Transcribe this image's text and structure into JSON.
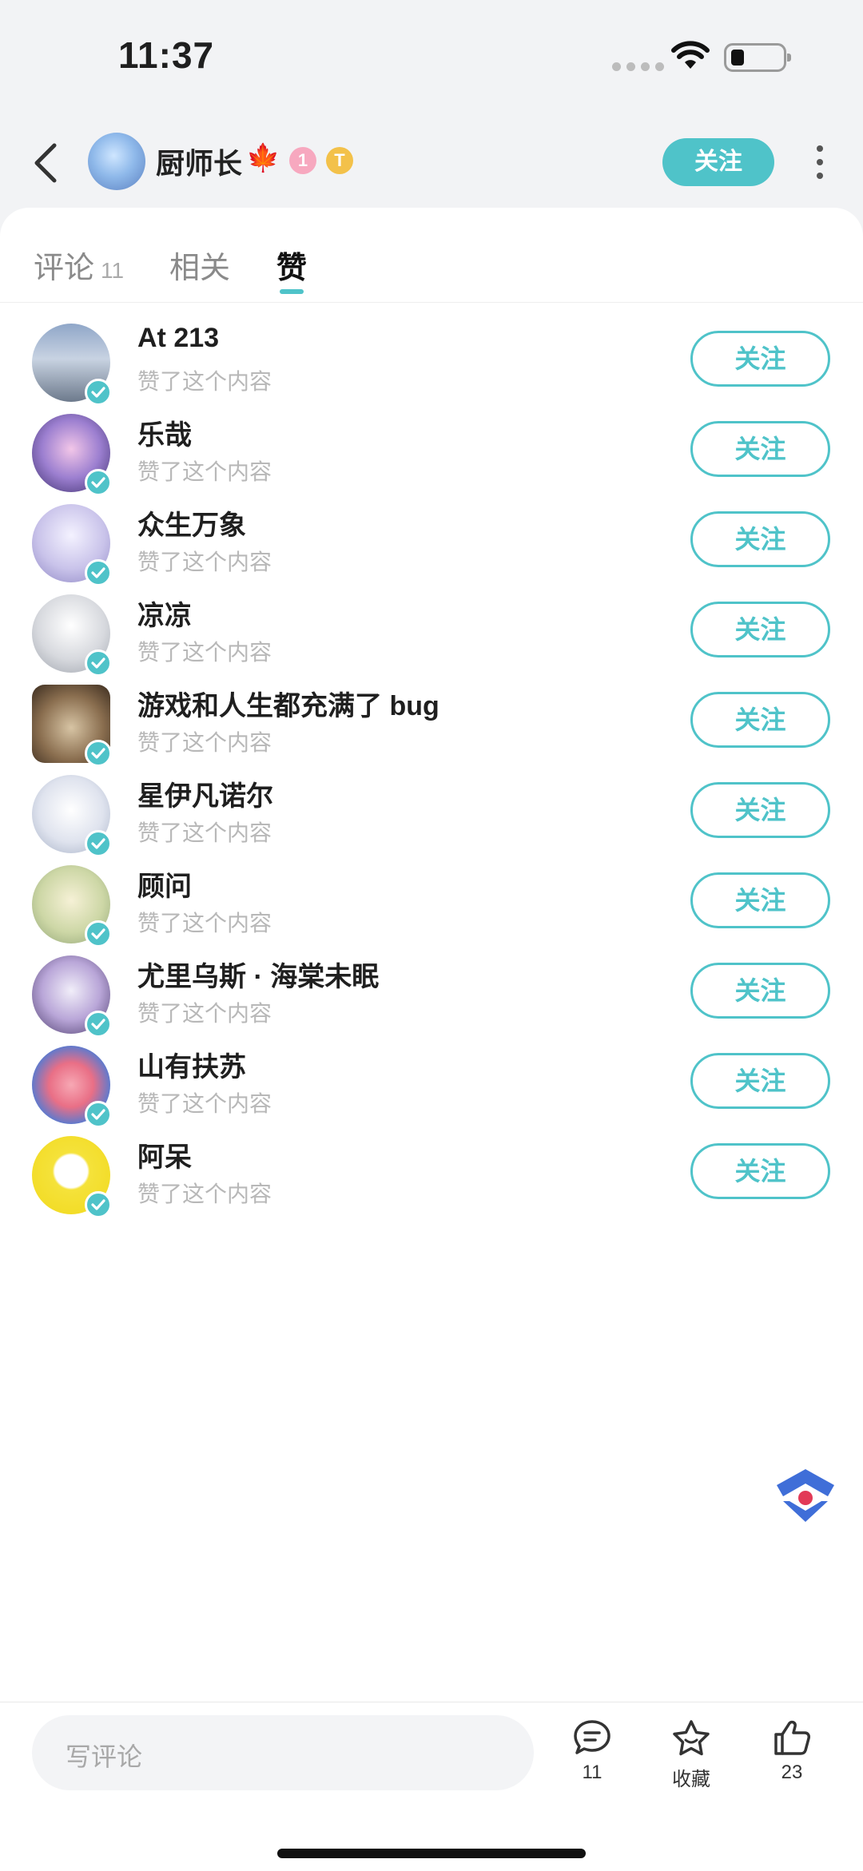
{
  "status": {
    "time": "11:37"
  },
  "header": {
    "username": "厨师长",
    "badge1": "1",
    "badge2": "T",
    "follow_label": "关注"
  },
  "tabs": [
    {
      "label": "评论",
      "count": "11"
    },
    {
      "label": "相关"
    },
    {
      "label": "赞"
    }
  ],
  "likes": [
    {
      "name": "At 213",
      "subtitle": "赞了这个内容",
      "button": "关注"
    },
    {
      "name": "乐哉",
      "subtitle": "赞了这个内容",
      "button": "关注"
    },
    {
      "name": "众生万象",
      "subtitle": "赞了这个内容",
      "button": "关注"
    },
    {
      "name": "凉凉",
      "subtitle": "赞了这个内容",
      "button": "关注"
    },
    {
      "name": "游戏和人生都充满了 bug",
      "subtitle": "赞了这个内容",
      "button": "关注"
    },
    {
      "name": "星伊凡诺尔",
      "subtitle": "赞了这个内容",
      "button": "关注"
    },
    {
      "name": "顾问",
      "subtitle": "赞了这个内容",
      "button": "关注"
    },
    {
      "name": "尤里乌斯 · 海棠未眠",
      "subtitle": "赞了这个内容",
      "button": "关注"
    },
    {
      "name": "山有扶苏",
      "subtitle": "赞了这个内容",
      "button": "关注"
    },
    {
      "name": "阿呆",
      "subtitle": "赞了这个内容",
      "button": "关注"
    }
  ],
  "bottom": {
    "comment_placeholder": "写评论",
    "comment_count": "11",
    "favorite_label": "收藏",
    "like_count": "23"
  },
  "colors": {
    "accent": "#4fc3c9"
  },
  "icons": [
    "back-arrow-icon",
    "more-icon",
    "verified-icon",
    "comment-icon",
    "star-icon",
    "thumbs-up-icon",
    "floating-logo-icon",
    "wifi-icon",
    "battery-icon"
  ]
}
